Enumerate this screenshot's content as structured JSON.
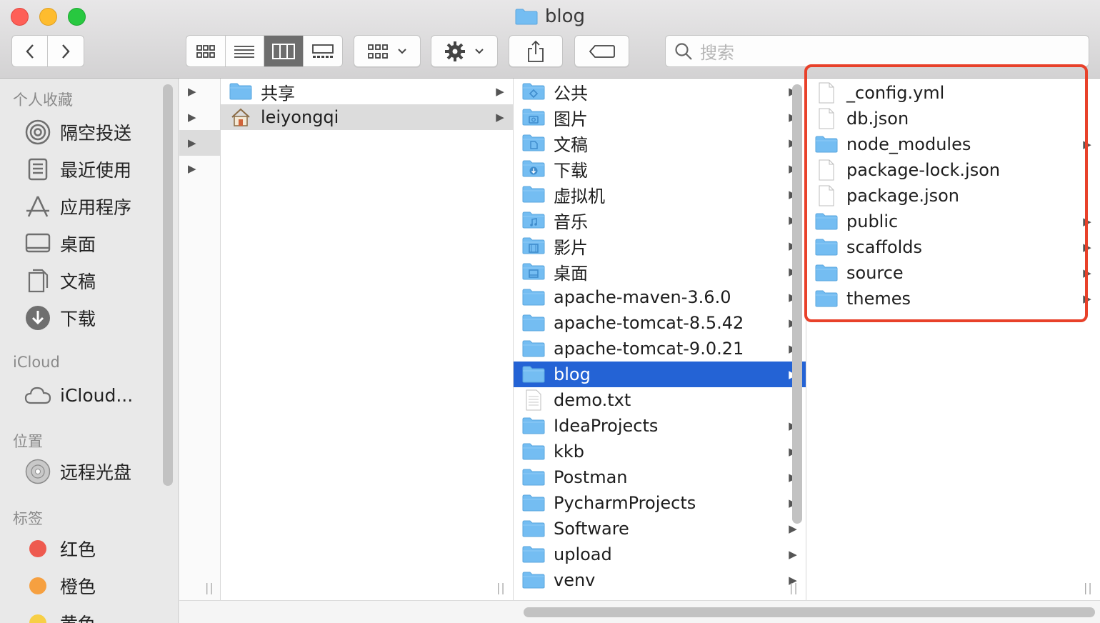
{
  "window": {
    "title": "blog"
  },
  "search": {
    "placeholder": "搜索"
  },
  "sidebar": {
    "favorites_heading": "个人收藏",
    "favorites": [
      {
        "label": "隔空投送",
        "icon": "airdrop-icon"
      },
      {
        "label": "最近使用",
        "icon": "recents-icon"
      },
      {
        "label": "应用程序",
        "icon": "applications-icon"
      },
      {
        "label": "桌面",
        "icon": "desktop-icon"
      },
      {
        "label": "文稿",
        "icon": "documents-icon"
      },
      {
        "label": "下载",
        "icon": "downloads-icon"
      }
    ],
    "icloud_heading": "iCloud",
    "icloud": [
      {
        "label": "iCloud...",
        "icon": "cloud-icon"
      }
    ],
    "locations_heading": "位置",
    "locations": [
      {
        "label": "远程光盘",
        "icon": "disc-icon"
      }
    ],
    "tags_heading": "标签",
    "tags": [
      {
        "label": "红色",
        "color": "#ee5a4f"
      },
      {
        "label": "橙色",
        "color": "#f6a040"
      },
      {
        "label": "黄色",
        "color": "#f7cf46"
      }
    ]
  },
  "columns": {
    "col1": [
      {
        "label": "共享",
        "kind": "folder"
      },
      {
        "label": "leiyongqi",
        "kind": "home"
      }
    ],
    "col2": [
      {
        "label": "公共",
        "kind": "folder-public"
      },
      {
        "label": "图片",
        "kind": "folder-pictures"
      },
      {
        "label": "文稿",
        "kind": "folder-documents"
      },
      {
        "label": "下载",
        "kind": "folder-downloads"
      },
      {
        "label": "虚拟机",
        "kind": "folder"
      },
      {
        "label": "音乐",
        "kind": "folder-music"
      },
      {
        "label": "影片",
        "kind": "folder-movies"
      },
      {
        "label": "桌面",
        "kind": "folder-desktop"
      },
      {
        "label": "apache-maven-3.6.0",
        "kind": "folder"
      },
      {
        "label": "apache-tomcat-8.5.42",
        "kind": "folder"
      },
      {
        "label": "apache-tomcat-9.0.21",
        "kind": "folder"
      },
      {
        "label": "blog",
        "kind": "folder",
        "selected": true
      },
      {
        "label": "demo.txt",
        "kind": "text"
      },
      {
        "label": "IdeaProjects",
        "kind": "folder"
      },
      {
        "label": "kkb",
        "kind": "folder"
      },
      {
        "label": "Postman",
        "kind": "folder"
      },
      {
        "label": "PycharmProjects",
        "kind": "folder"
      },
      {
        "label": "Software",
        "kind": "folder"
      },
      {
        "label": "upload",
        "kind": "folder"
      },
      {
        "label": "venv",
        "kind": "folder"
      }
    ],
    "col3": [
      {
        "label": "_config.yml",
        "kind": "file"
      },
      {
        "label": "db.json",
        "kind": "file"
      },
      {
        "label": "node_modules",
        "kind": "folder"
      },
      {
        "label": "package-lock.json",
        "kind": "file"
      },
      {
        "label": "package.json",
        "kind": "file"
      },
      {
        "label": "public",
        "kind": "folder"
      },
      {
        "label": "scaffolds",
        "kind": "folder"
      },
      {
        "label": "source",
        "kind": "folder"
      },
      {
        "label": "themes",
        "kind": "folder"
      }
    ]
  },
  "colors": {
    "selection": "#2463d5",
    "folder": "#6cb8f0",
    "highlight": "#e8412a"
  }
}
